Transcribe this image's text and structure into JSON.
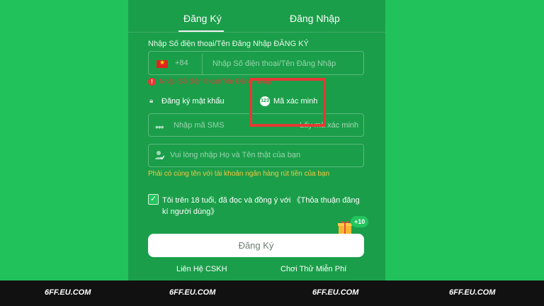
{
  "tabs": {
    "register": "Đăng Ký",
    "login": "Đăng Nhập"
  },
  "form": {
    "section_label": "Nhập Số điện thoại/Tên Đăng Nhập ĐĂNG KÝ",
    "country_code": "+84",
    "phone_placeholder": "Nhập Số điện thoại/Tên Đăng Nhập",
    "error_message": "Nhập Số điện thoại/Tên Đăng Nhập",
    "option_password": "Đăng ký mật khẩu",
    "option_code": "Mã xác minh",
    "option_code_badge": "123",
    "sms_placeholder": "Nhập mã SMS",
    "get_code": "Lấy mã xác minh",
    "name_placeholder": "Vui lòng nhập Họ và Tên thật của bạn",
    "name_warning": "Phải có cùng tên với tài khoản ngân hàng rút tiền của bạn",
    "agree_text": "Tôi trên 18 tuổi, đã đọc và đồng ý với 《Thỏa thuận đăng kí người dùng》",
    "agree_checked": true,
    "bonus": "+10",
    "submit": "Đăng Ký"
  },
  "footer": {
    "contact": "Liên Hệ CSKH",
    "trial": "Chơi Thử Miễn Phí"
  },
  "watermark": [
    "6FF.EU.COM",
    "6FF.EU.COM",
    "6FF.EU.COM",
    "6FF.EU.COM"
  ],
  "colors": {
    "background": "#21c25c",
    "panel": "#1b9e4a",
    "error": "#e53935",
    "warning": "#f5c542",
    "highlight_box": "#e53935"
  }
}
